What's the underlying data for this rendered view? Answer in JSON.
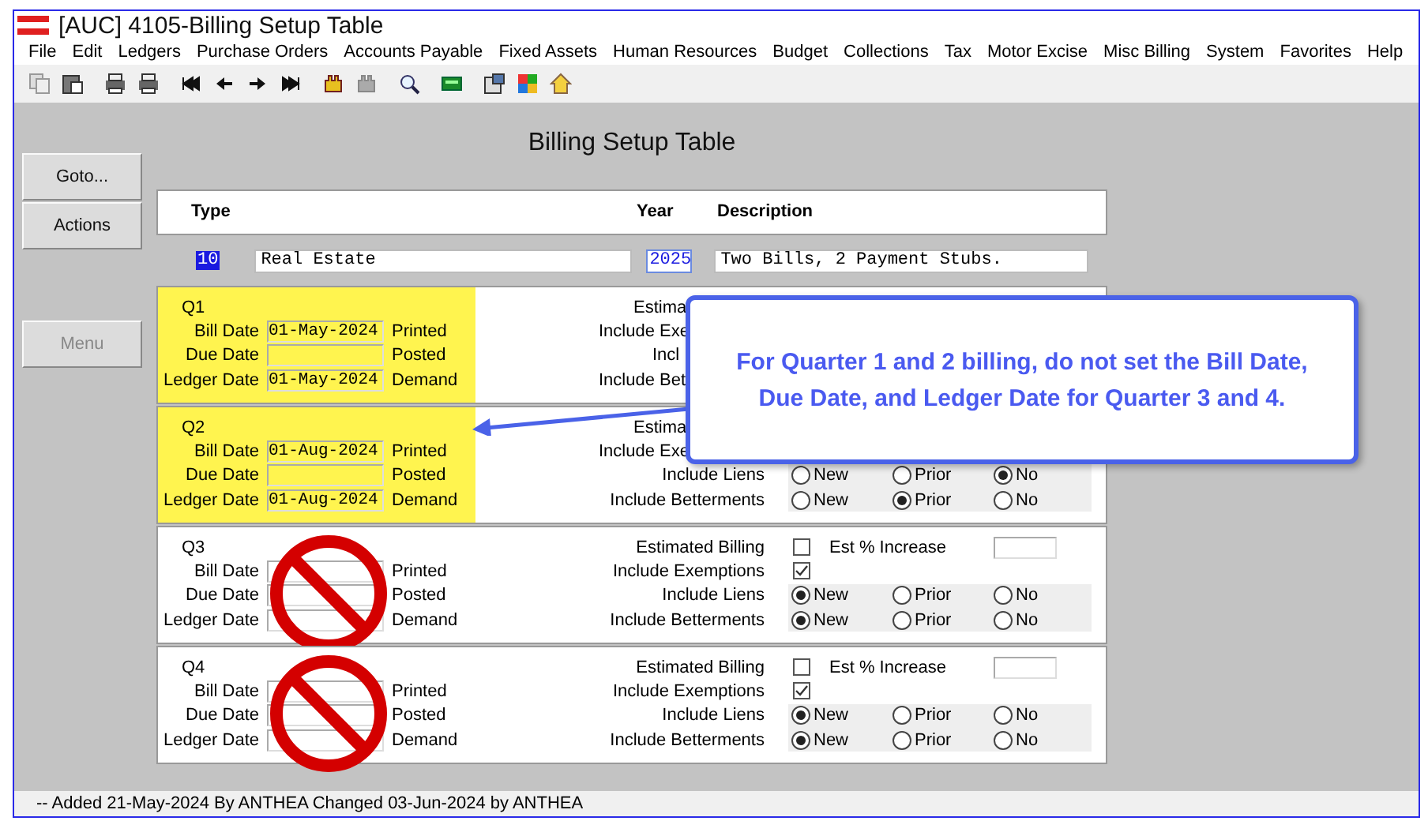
{
  "window": {
    "title": "[AUC] 4105-Billing Setup Table"
  },
  "menu": [
    "File",
    "Edit",
    "Ledgers",
    "Purchase Orders",
    "Accounts Payable",
    "Fixed Assets",
    "Human Resources",
    "Budget",
    "Collections",
    "Tax",
    "Motor Excise",
    "Misc Billing",
    "System",
    "Favorites",
    "Help"
  ],
  "side_buttons": [
    {
      "label": "Goto...",
      "disabled": false
    },
    {
      "label": "Actions",
      "disabled": false
    },
    {
      "label": "Menu",
      "disabled": true
    }
  ],
  "page_title": "Billing Setup Table",
  "header": {
    "columns": [
      "Type",
      "Year",
      "Description"
    ],
    "type_code": "10",
    "type_name": "Real Estate",
    "year": "2025",
    "description": "Two Bills, 2 Payment Stubs."
  },
  "quarters": [
    {
      "label": "Q1",
      "highlighted": true,
      "blocked": false,
      "dates": [
        {
          "label": "Bill Date",
          "value": "01-May-2024",
          "status": "Printed"
        },
        {
          "label": "Due Date",
          "status": "Posted"
        },
        {
          "label": "Ledger Date",
          "value": "01-May-2024",
          "status": "Demand"
        }
      ],
      "options": [
        {
          "kind": "estimated",
          "label": "Estima",
          "cut": true
        },
        {
          "kind": "exemptions",
          "label": "Include Exe",
          "cut": true
        },
        {
          "kind": "liens",
          "label": "Incl",
          "cut": true
        },
        {
          "kind": "betterments",
          "label": "Include Bet",
          "cut": true
        }
      ]
    },
    {
      "label": "Q2",
      "highlighted": true,
      "blocked": false,
      "dates": [
        {
          "label": "Bill Date",
          "value": "01-Aug-2024",
          "status": "Printed"
        },
        {
          "label": "Due Date",
          "status": "Posted"
        },
        {
          "label": "Ledger Date",
          "value": "01-Aug-2024",
          "status": "Demand"
        }
      ],
      "options": [
        {
          "kind": "estimated",
          "label": "Estima",
          "cut": true
        },
        {
          "kind": "exemptions",
          "label": "Include Exe",
          "cut": true
        },
        {
          "kind": "liens",
          "label": "Include Liens",
          "cut": false,
          "choices": [
            {
              "label": "New",
              "selected": false
            },
            {
              "label": "Prior",
              "selected": false
            },
            {
              "label": "No",
              "selected": true
            }
          ]
        },
        {
          "kind": "betterments",
          "label": "Include Betterments",
          "cut": false,
          "choices": [
            {
              "label": "New",
              "selected": false
            },
            {
              "label": "Prior",
              "selected": true
            },
            {
              "label": "No",
              "selected": false
            }
          ]
        }
      ]
    },
    {
      "label": "Q3",
      "highlighted": false,
      "blocked": true,
      "dates": [
        {
          "label": "Bill Date",
          "status": "Printed"
        },
        {
          "label": "Due Date",
          "status": "Posted"
        },
        {
          "label": "Ledger Date",
          "status": "Demand"
        }
      ],
      "options": [
        {
          "kind": "estimated",
          "label": "Estimated Billing",
          "cut": false,
          "checked": false,
          "extra_label": "Est % Increase"
        },
        {
          "kind": "exemptions",
          "label": "Include Exemptions",
          "cut": false,
          "checked": true
        },
        {
          "kind": "liens",
          "label": "Include Liens",
          "cut": false,
          "choices": [
            {
              "label": "New",
              "selected": true
            },
            {
              "label": "Prior",
              "selected": false
            },
            {
              "label": "No",
              "selected": false
            }
          ]
        },
        {
          "kind": "betterments",
          "label": "Include Betterments",
          "cut": false,
          "choices": [
            {
              "label": "New",
              "selected": true
            },
            {
              "label": "Prior",
              "selected": false
            },
            {
              "label": "No",
              "selected": false
            }
          ]
        }
      ]
    },
    {
      "label": "Q4",
      "highlighted": false,
      "blocked": true,
      "dates": [
        {
          "label": "Bill Date",
          "status": "Printed"
        },
        {
          "label": "Due Date",
          "status": "Posted"
        },
        {
          "label": "Ledger Date",
          "status": "Demand"
        }
      ],
      "options": [
        {
          "kind": "estimated",
          "label": "Estimated Billing",
          "cut": false,
          "checked": false,
          "extra_label": "Est % Increase"
        },
        {
          "kind": "exemptions",
          "label": "Include Exemptions",
          "cut": false,
          "checked": true
        },
        {
          "kind": "liens",
          "label": "Include Liens",
          "cut": false,
          "choices": [
            {
              "label": "New",
              "selected": true
            },
            {
              "label": "Prior",
              "selected": false
            },
            {
              "label": "No",
              "selected": false
            }
          ]
        },
        {
          "kind": "betterments",
          "label": "Include Betterments",
          "cut": false,
          "choices": [
            {
              "label": "New",
              "selected": true
            },
            {
              "label": "Prior",
              "selected": false
            },
            {
              "label": "No",
              "selected": false
            }
          ]
        }
      ]
    }
  ],
  "callout": {
    "text": "For Quarter 1 and 2 billing, do not set the Bill Date, Due Date, and Ledger Date for Quarter 3 and 4."
  },
  "status_bar": "-- Added 21-May-2024 By ANTHEA Changed 03-Jun-2024 by ANTHEA"
}
